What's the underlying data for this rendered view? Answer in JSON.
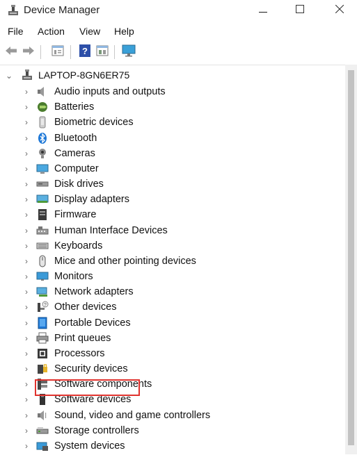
{
  "window": {
    "title": "Device Manager"
  },
  "menu": [
    "File",
    "Action",
    "View",
    "Help"
  ],
  "toolbar": [
    "back-icon",
    "forward-icon",
    "properties-icon",
    "help-icon",
    "view-icon",
    "monitor-icon"
  ],
  "tree": {
    "root": "LAPTOP-8GN6ER75",
    "items": [
      {
        "label": "Audio inputs and outputs",
        "icon": "speaker-icon"
      },
      {
        "label": "Batteries",
        "icon": "battery-icon"
      },
      {
        "label": "Biometric devices",
        "icon": "biometric-icon"
      },
      {
        "label": "Bluetooth",
        "icon": "bluetooth-icon"
      },
      {
        "label": "Cameras",
        "icon": "camera-icon"
      },
      {
        "label": "Computer",
        "icon": "computer-icon"
      },
      {
        "label": "Disk drives",
        "icon": "disk-icon"
      },
      {
        "label": "Display adapters",
        "icon": "display-adapter-icon"
      },
      {
        "label": "Firmware",
        "icon": "firmware-icon"
      },
      {
        "label": "Human Interface Devices",
        "icon": "hid-icon"
      },
      {
        "label": "Keyboards",
        "icon": "keyboard-icon"
      },
      {
        "label": "Mice and other pointing devices",
        "icon": "mouse-icon"
      },
      {
        "label": "Monitors",
        "icon": "monitor-icon"
      },
      {
        "label": "Network adapters",
        "icon": "network-icon"
      },
      {
        "label": "Other devices",
        "icon": "other-devices-icon"
      },
      {
        "label": "Portable Devices",
        "icon": "portable-device-icon"
      },
      {
        "label": "Print queues",
        "icon": "printer-icon"
      },
      {
        "label": "Processors",
        "icon": "processor-icon"
      },
      {
        "label": "Security devices",
        "icon": "security-icon"
      },
      {
        "label": "Software components",
        "icon": "software-component-icon"
      },
      {
        "label": "Software devices",
        "icon": "software-device-icon"
      },
      {
        "label": "Sound, video and game controllers",
        "icon": "sound-icon"
      },
      {
        "label": "Storage controllers",
        "icon": "storage-icon"
      },
      {
        "label": "System devices",
        "icon": "system-icon"
      }
    ]
  },
  "highlight": {
    "item": "Portable Devices",
    "color": "#e0322d"
  },
  "colors": {
    "accent": "#1e78d7",
    "highlight_border": "#e0322d"
  }
}
